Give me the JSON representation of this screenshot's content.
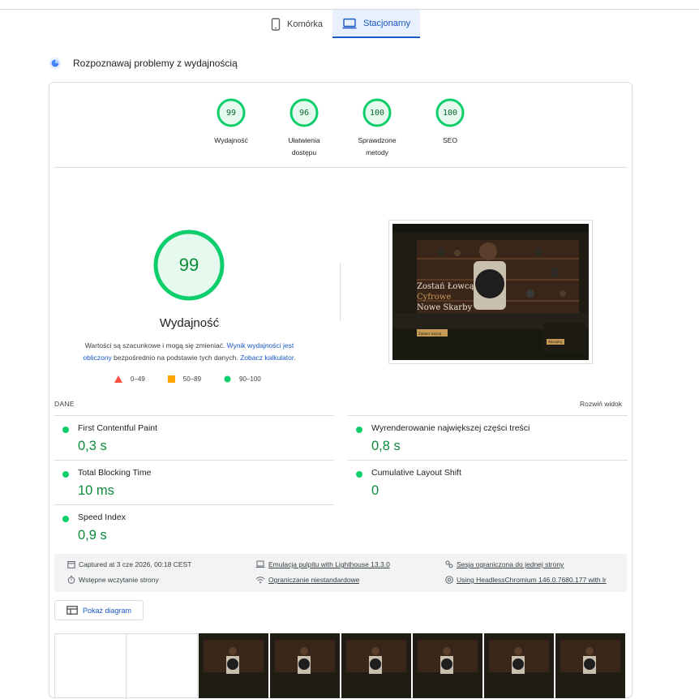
{
  "tabs": [
    {
      "label": "Komórka",
      "icon": "phone-icon",
      "active": false
    },
    {
      "label": "Stacjonarny",
      "icon": "desktop-icon",
      "active": true
    }
  ],
  "section_title": "Rozpoznawaj problemy z wydajnością",
  "categories": [
    {
      "score": "99",
      "label_line1": "Wydajność",
      "label_line2": ""
    },
    {
      "score": "96",
      "label_line1": "Ułatwienia",
      "label_line2": "dostępu"
    },
    {
      "score": "100",
      "label_line1": "Sprawdzone",
      "label_line2": "metody"
    },
    {
      "score": "100",
      "label_line1": "SEO",
      "label_line2": ""
    }
  ],
  "performance": {
    "score": "99",
    "title": "Wydajność",
    "note_text1": "Wartości są szacunkowe i mogą się zmieniać. ",
    "note_link1": "Wynik wydajności jest obliczony",
    "note_text2": " bezpośrednio na podstawie tych danych. ",
    "note_link2": "Zobacz kalkulator",
    "note_text3": "."
  },
  "legend": [
    {
      "range": "0–49",
      "icon": "triangle-icon",
      "color": "#ff4e42"
    },
    {
      "range": "50–89",
      "icon": "square-icon",
      "color": "#ffa400"
    },
    {
      "range": "90–100",
      "icon": "circle-icon",
      "color": "#0cce6b"
    }
  ],
  "screenshot": {
    "headline1": "Zostań Łowcą",
    "headline2": "Cyfrowe",
    "headline3": "Nowe Skarby",
    "cta": "Zobacz więcej",
    "cookie_btn": "Akceptuj"
  },
  "metrics_header": "DANE",
  "expand_label": "Rozwiń widok",
  "metrics": [
    {
      "name": "First Contentful Paint",
      "value": "0,3 s"
    },
    {
      "name": "Wyrenderowanie największej części treści",
      "value": "0,8 s"
    },
    {
      "name": "Total Blocking Time",
      "value": "10 ms"
    },
    {
      "name": "Cumulative Layout Shift",
      "value": "0"
    },
    {
      "name": "Speed Index",
      "value": "0,9 s"
    }
  ],
  "info": {
    "captured": "Captured at 3 cze 2026, 00:18 CEST",
    "initial_load": "Wstępne wczytanie strony",
    "emulation": "Emulacja pulpitu with Lighthouse 13.3.0",
    "throttling": "Ograniczanie niestandardowe",
    "session": "Sesja ograniczona do jednej strony",
    "browser": "Using HeadlessChromium 146.0.7680.177 with lr"
  },
  "diagram_button": "Pokaż diagram",
  "colors": {
    "good": "#0cce6b",
    "good_text": "#0d8a3a",
    "accent": "#1a56c4"
  }
}
